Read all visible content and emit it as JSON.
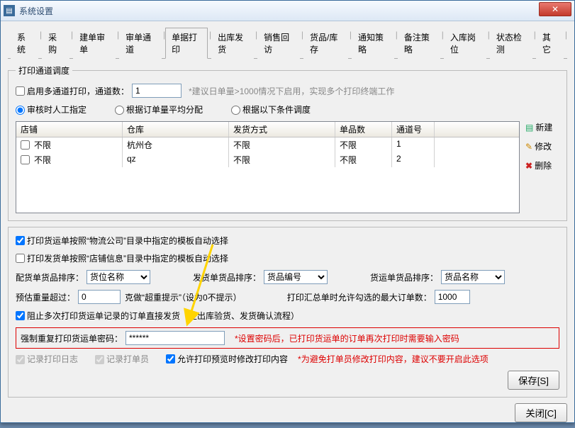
{
  "window": {
    "title": "系统设置"
  },
  "tabs": [
    "系统",
    "采购",
    "建单审单",
    "审单通道",
    "单据打印",
    "出库发货",
    "销售回访",
    "货品/库存",
    "通知策略",
    "备注策略",
    "入库岗位",
    "状态检测",
    "其它"
  ],
  "active_tab": 4,
  "group1": {
    "legend": "打印通道调度",
    "cb_multi": "启用多通道打印，通道数：",
    "channels_value": "1",
    "multi_hint": "*建议日单量>1000情况下启用，实现多个打印终端工作",
    "radio1": "审核时人工指定",
    "radio2": "根据订单量平均分配",
    "radio3": "根据以下条件调度",
    "headers": [
      "店铺",
      "仓库",
      "发货方式",
      "单品数",
      "通道号"
    ],
    "rows": [
      {
        "shop": "不限",
        "wh": "杭州仓",
        "ship": "不限",
        "qty": "不限",
        "ch": "1"
      },
      {
        "shop": "不限",
        "wh": "qz",
        "ship": "不限",
        "qty": "不限",
        "ch": "2"
      }
    ],
    "act_new": "新建",
    "act_edit": "修改",
    "act_del": "删除"
  },
  "group2": {
    "cb1": "打印货运单按照“物流公司”目录中指定的模板自动选择",
    "cb2": "打印发货单按照“店铺信息”目录中指定的模板自动选择",
    "lbl_pick": "配货单货品排序：",
    "sel_pick": "货位名称",
    "lbl_ship": "发货单货品排序：",
    "sel_ship": "货品编号",
    "lbl_trans": "货运单货品排序：",
    "sel_trans": "货品名称",
    "lbl_weight": "预估重量超过：",
    "weight_val": "0",
    "weight_suffix": "克做“超重提示”（设为0不提示）",
    "lbl_max": "打印汇总单时允许勾选的最大订单数：",
    "max_val": "1000",
    "cb3": "阻止多次打印货运单记录的订单直接发货（走出库验货、发货确认流程）",
    "lbl_pwd": "强制重复打印货运单密码：",
    "pwd_val": "******",
    "pwd_hint": "*设置密码后，已打印货运单的订单再次打印时需要输入密码",
    "cb4": "记录打印日志",
    "cb5": "记录打单员",
    "cb6": "允许打印预览时修改打印内容",
    "cb6_hint": "*为避免打单员修改打印内容，建议不要开启此选项",
    "btn_save": "保存[S]"
  },
  "btn_close": "关闭[C]"
}
